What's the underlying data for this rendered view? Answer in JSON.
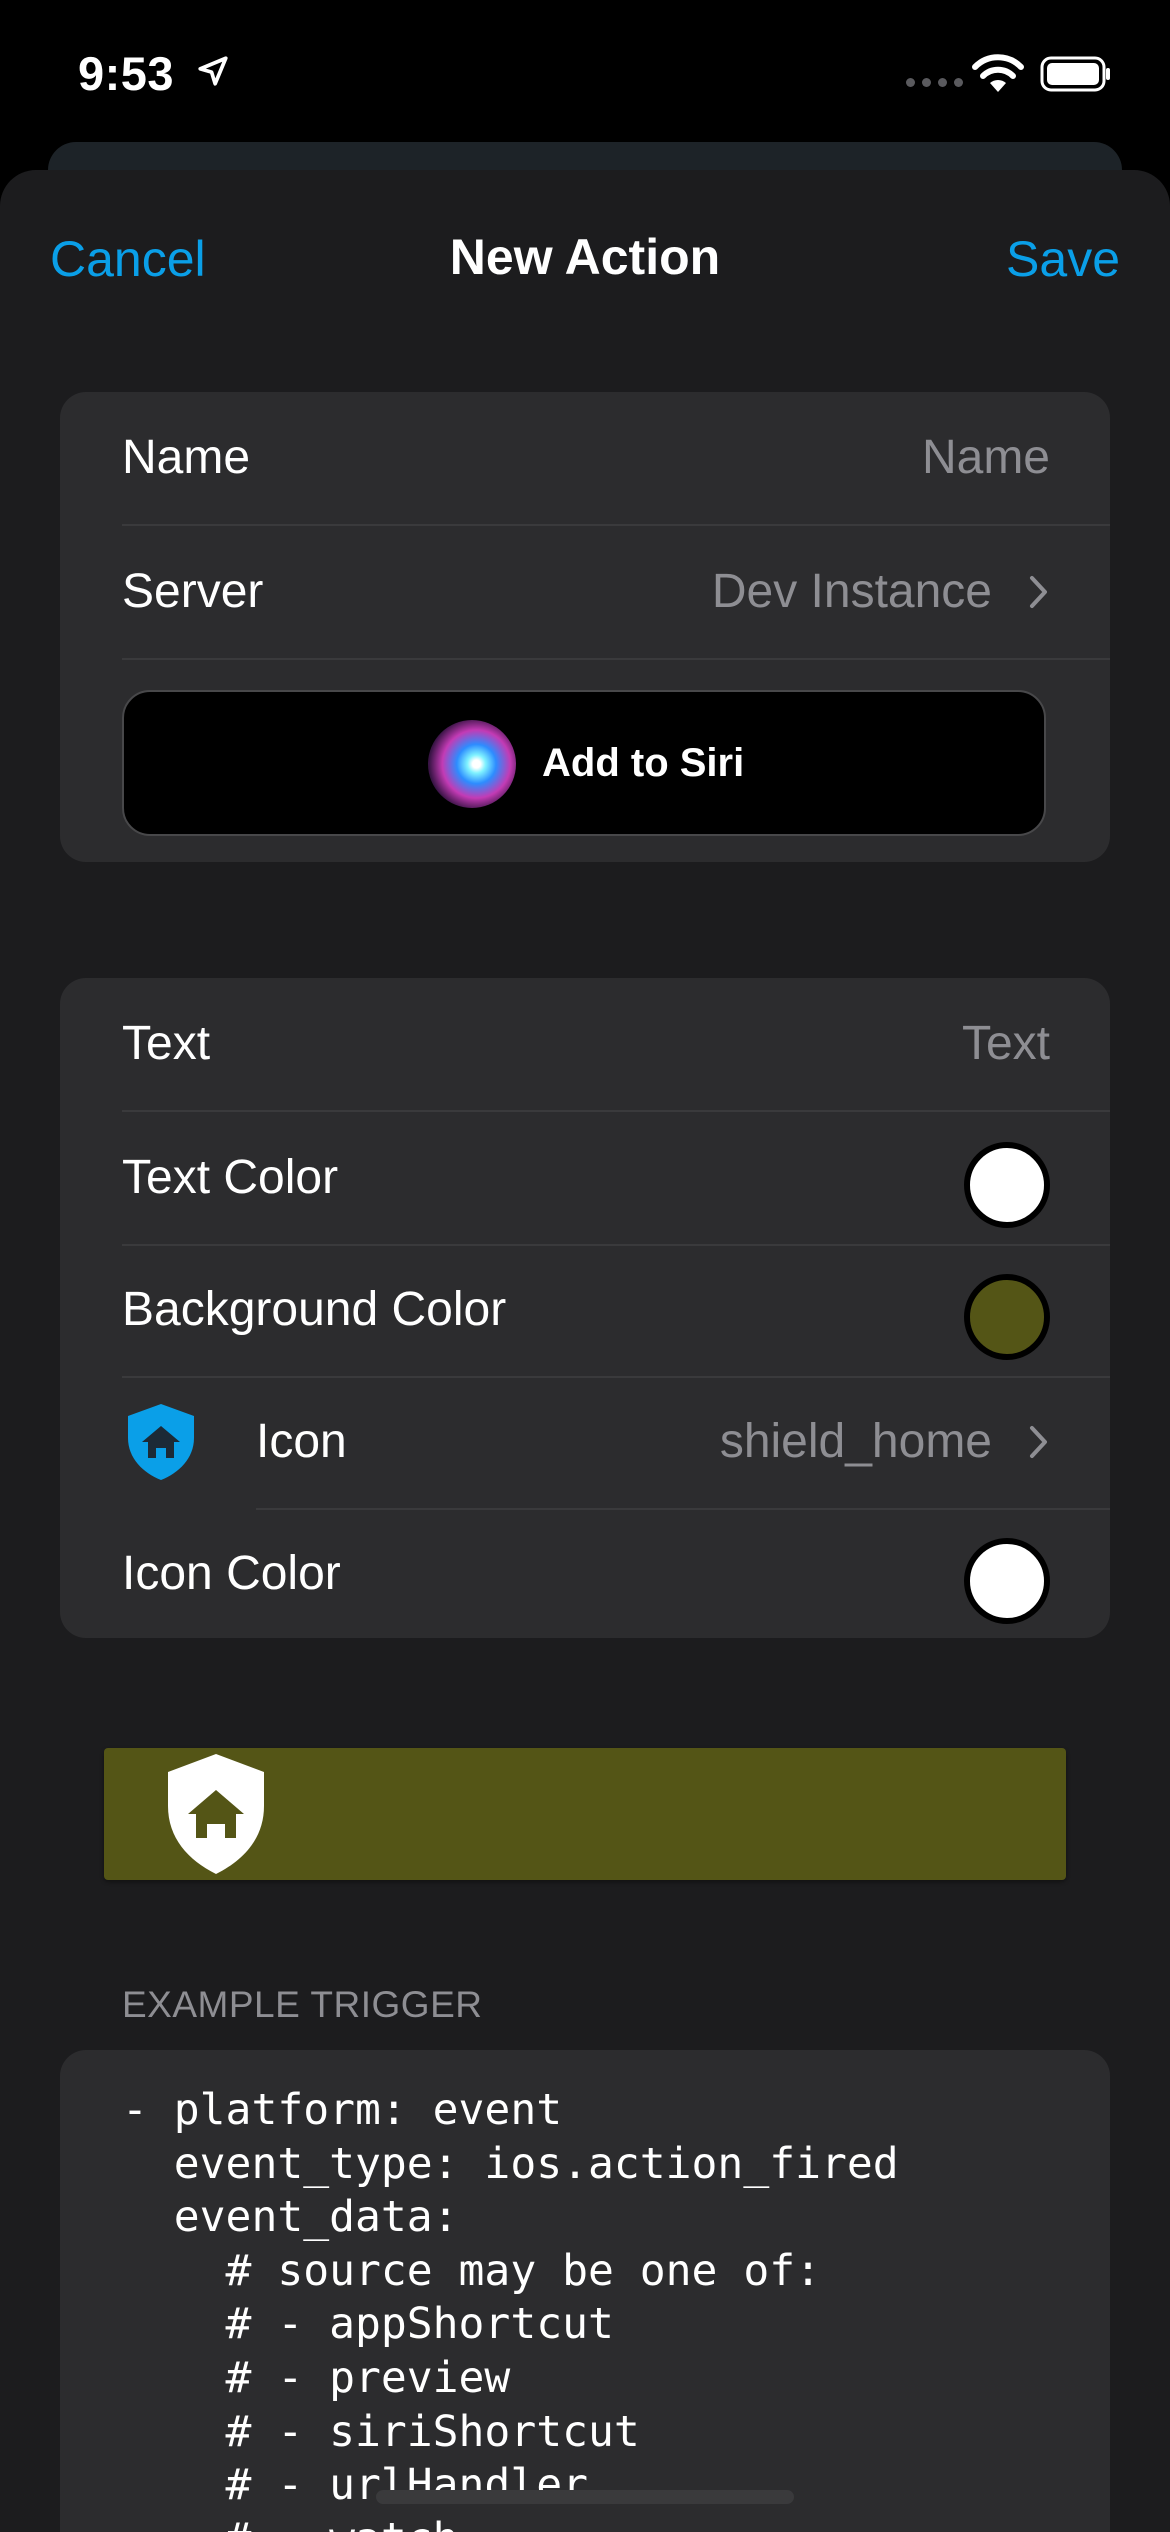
{
  "status_bar": {
    "time": "9:53"
  },
  "nav": {
    "cancel_label": "Cancel",
    "title": "New Action",
    "save_label": "Save"
  },
  "group1": {
    "name_label": "Name",
    "name_placeholder": "Name",
    "server_label": "Server",
    "server_value": "Dev Instance",
    "siri_label": "Add to Siri"
  },
  "group2": {
    "text_label": "Text",
    "text_placeholder": "Text",
    "text_color_label": "Text Color",
    "text_color": "#ffffff",
    "bg_color_label": "Background Color",
    "bg_color": "#545516",
    "icon_label": "Icon",
    "icon_value": "shield_home",
    "icon_color_label": "Icon Color",
    "icon_color": "#ffffff"
  },
  "colors": {
    "accent": "#0a9fe8",
    "icon_blue": "#0a9fe8"
  },
  "example": {
    "header": "EXAMPLE TRIGGER",
    "code": "- platform: event\n  event_type: ios.action_fired\n  event_data:\n    # source may be one of:\n    # - appShortcut\n    # - preview\n    # - siriShortcut\n    # - urlHandler\n    # - watch"
  }
}
